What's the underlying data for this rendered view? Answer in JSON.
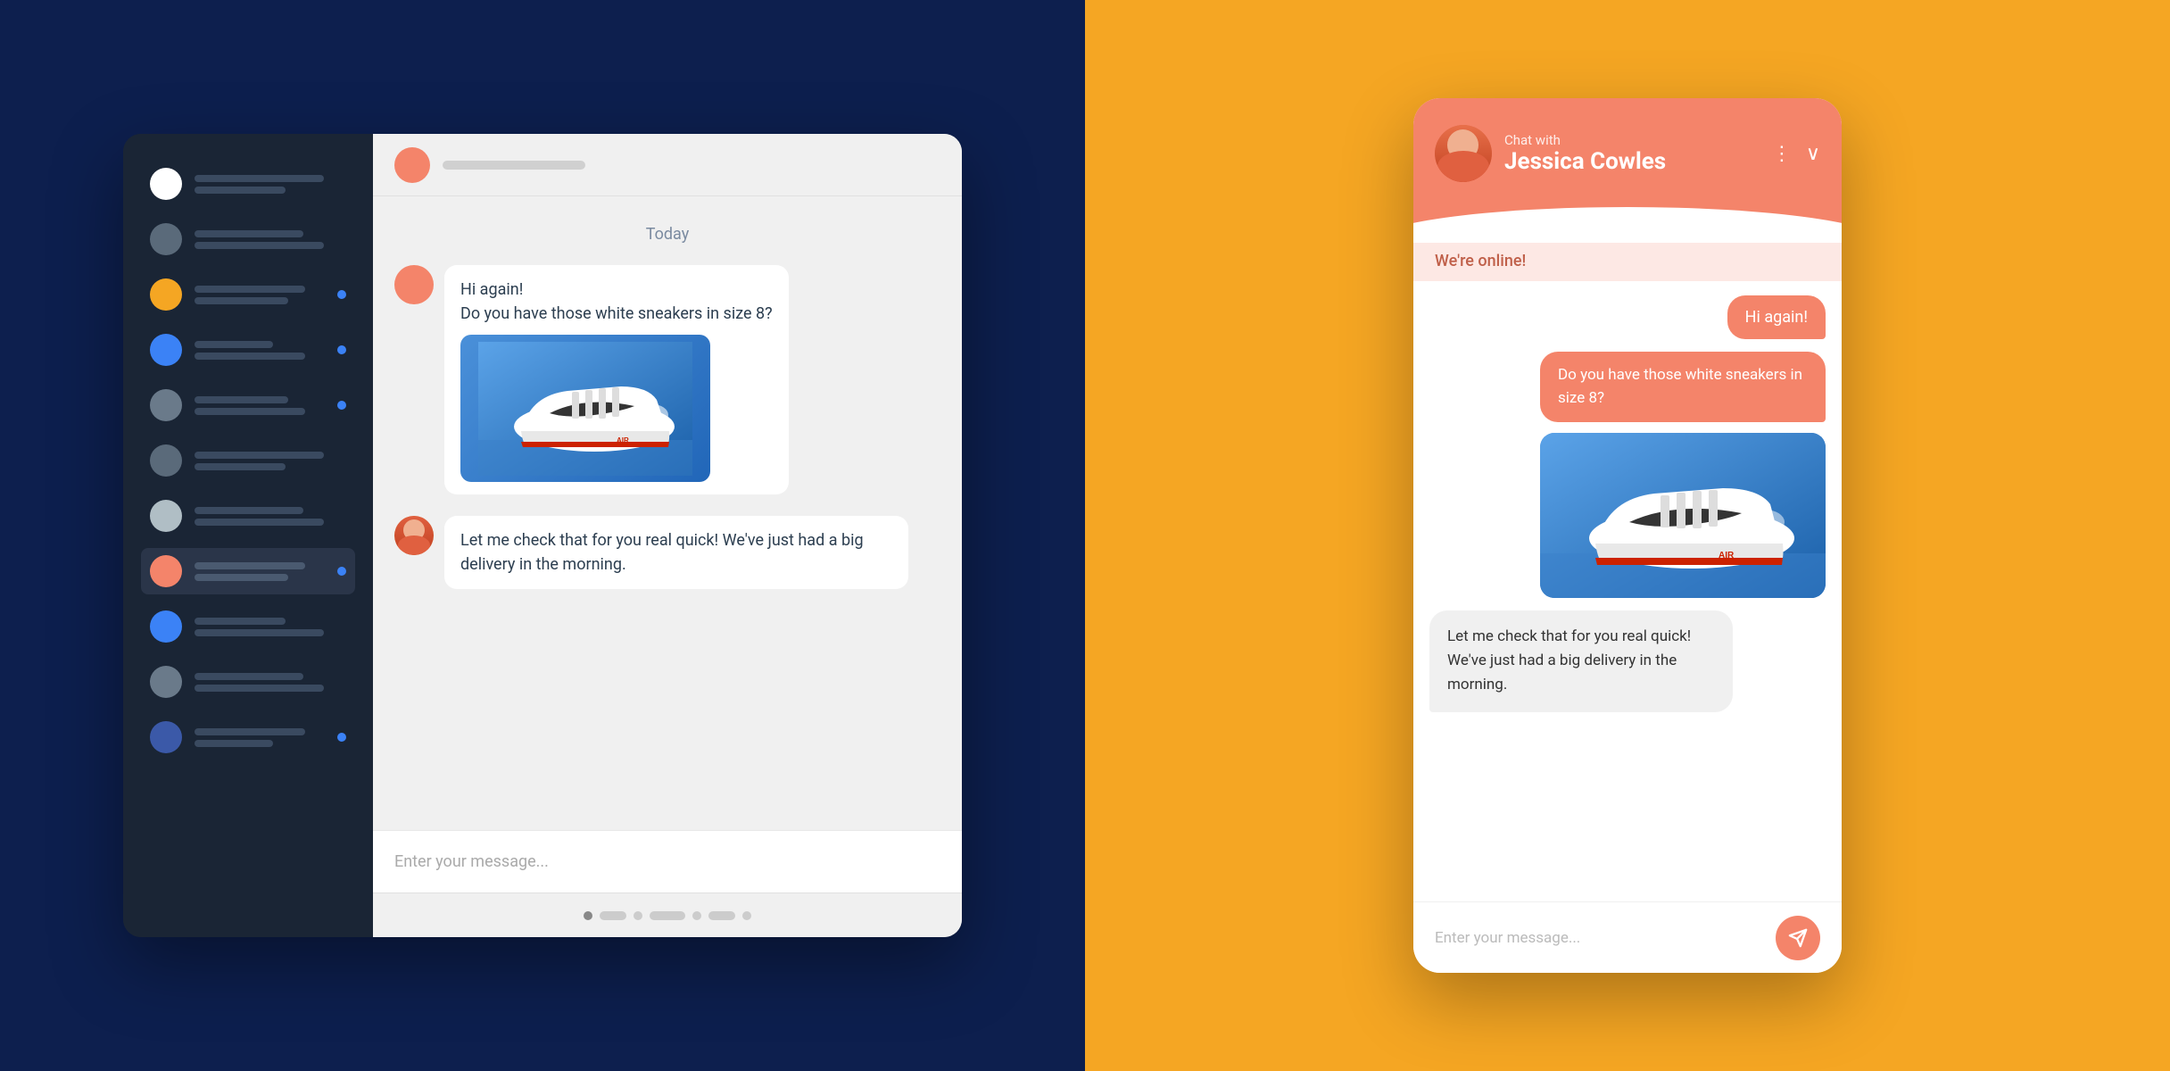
{
  "left_bg": "#0d1f4e",
  "right_bg": "#f5a623",
  "sidebar": {
    "items": [
      {
        "color": "#ffffff",
        "dot_color": null,
        "active": false
      },
      {
        "color": "#8898aa",
        "dot_color": null,
        "active": false
      },
      {
        "color": "#f5a623",
        "dot_color": "#3b82f6",
        "active": false
      },
      {
        "color": "#3b82f6",
        "dot_color": "#3b82f6",
        "active": false
      },
      {
        "color": "#8898aa",
        "dot_color": "#3b82f6",
        "active": false
      },
      {
        "color": "#8898aa",
        "dot_color": null,
        "active": false
      },
      {
        "color": "#ffffff",
        "dot_color": null,
        "active": false
      },
      {
        "color": "#f4846a",
        "dot_color": "#3b82f6",
        "active": true
      },
      {
        "color": "#3b82f6",
        "dot_color": null,
        "active": false
      },
      {
        "color": "#8898aa",
        "dot_color": null,
        "active": false
      },
      {
        "color": "#3b59a8",
        "dot_color": "#3b82f6",
        "active": false
      }
    ]
  },
  "chat_header": {
    "date_label": "Today"
  },
  "messages": [
    {
      "type": "incoming",
      "text": "Hi again!\nDo you have those white sneakers in size 8?",
      "has_image": true
    },
    {
      "type": "outgoing_agent",
      "text": "Let me check that for you real quick! We've just had a big delivery in the morning."
    }
  ],
  "input_placeholder": "Enter your message...",
  "mobile": {
    "header": {
      "chat_with_label": "Chat with",
      "contact_name": "Jessica Cowles",
      "online_text": "We're online!"
    },
    "messages": [
      {
        "type": "right_pink",
        "text": "Hi again!"
      },
      {
        "type": "right_pink_large",
        "text": "Do you have those white sneakers in size 8?",
        "has_image": true
      },
      {
        "type": "left_gray",
        "text": "Let me check that for you real quick! We've just had a big delivery in the morning."
      }
    ],
    "input_placeholder": "Enter your message..."
  }
}
